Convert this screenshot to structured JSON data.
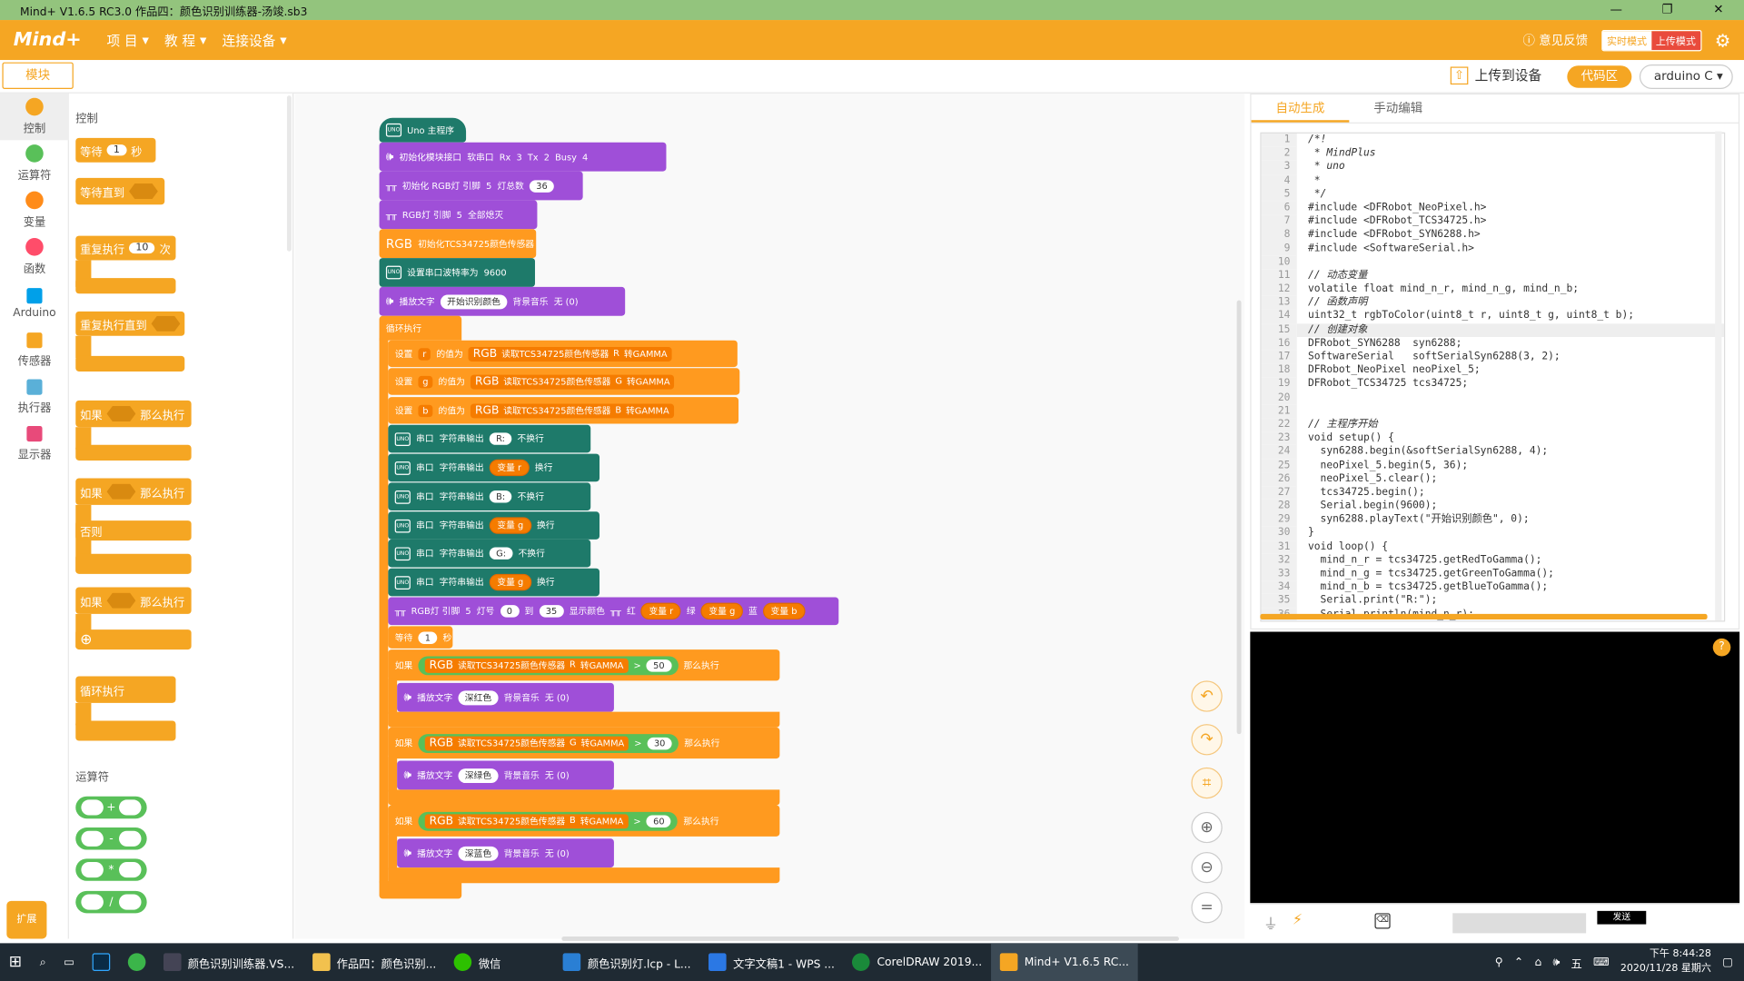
{
  "window": {
    "title": "Mind+ V1.6.5 RC3.0    作品四：颜色识别训练器-汤竣.sb3",
    "min": "—",
    "max": "❐",
    "close": "✕"
  },
  "menubar": {
    "logo": "Mind+",
    "items": [
      "项 目",
      "教 程",
      "连接设备"
    ],
    "feedback": "意见反馈",
    "mode_realtime": "实时模式",
    "mode_upload": "上传模式"
  },
  "toolbar": {
    "blocks_tab": "模块",
    "upload": "上传到设备",
    "code_btn": "代码区",
    "language": "arduino C"
  },
  "categories": [
    {
      "label": "控制",
      "color": "#f5a623"
    },
    {
      "label": "运算符",
      "color": "#59c059"
    },
    {
      "label": "变量",
      "color": "#ff8c1a"
    },
    {
      "label": "函数",
      "color": "#ff4d6a"
    },
    {
      "label": "Arduino",
      "color": "#00a0e9"
    },
    {
      "label": "传感器",
      "color": "#f5a623"
    },
    {
      "label": "执行器",
      "color": "#5ab0d8"
    },
    {
      "label": "显示器",
      "color": "#e84a7a"
    }
  ],
  "ext_button": "扩展",
  "flyout": {
    "control_title": "控制",
    "wait": "等待",
    "wait_val": "1",
    "wait_unit": "秒",
    "wait_until": "等待直到",
    "repeat": "重复执行",
    "repeat_val": "10",
    "repeat_unit": "次",
    "repeat_until": "重复执行直到",
    "if1": "如果",
    "then1": "那么执行",
    "if2": "如果",
    "then2": "那么执行",
    "else2": "否则",
    "if3": "如果",
    "then3": "那么执行",
    "forever": "循环执行",
    "operators_title": "运算符",
    "ops": [
      "+",
      "-",
      "*",
      "/"
    ]
  },
  "script": {
    "main": "Uno 主程序",
    "b1": {
      "label": "初始化模块接口",
      "mode": "软串口",
      "rx": "Rx",
      "rxv": "3",
      "tx": "Tx",
      "txv": "2",
      "busy": "Busy",
      "busyv": "4"
    },
    "b2": {
      "label": "初始化 RGB灯 引脚",
      "pin": "5",
      "cnt_label": "灯总数",
      "cnt": "36"
    },
    "b3": {
      "label": "RGB灯 引脚",
      "pin": "5",
      "action": "全部熄灭"
    },
    "b4": {
      "rgb": "RGB",
      "label": "初始化TCS34725颜色传感器"
    },
    "b5": {
      "label": "设置串口波特率为",
      "val": "9600"
    },
    "b6": {
      "label": "播放文字",
      "text": "开始识别颜色",
      "bg": "背景音乐",
      "bgv": "无 (0)"
    },
    "forever": "循环执行",
    "set": [
      {
        "label": "设置",
        "var": "r",
        "to": "的值为",
        "rgb": "RGB",
        "sensor": "读取TCS34725颜色传感器",
        "ch": "R",
        "gamma": "转GAMMA"
      },
      {
        "label": "设置",
        "var": "g",
        "to": "的值为",
        "rgb": "RGB",
        "sensor": "读取TCS34725颜色传感器",
        "ch": "G",
        "gamma": "转GAMMA"
      },
      {
        "label": "设置",
        "var": "b",
        "to": "的值为",
        "rgb": "RGB",
        "sensor": "读取TCS34725颜色传感器",
        "ch": "B",
        "gamma": "转GAMMA"
      }
    ],
    "serial": [
      {
        "port": "串口",
        "out": "字符串输出",
        "val": "R:",
        "nl": "不换行",
        "var": false
      },
      {
        "port": "串口",
        "out": "字符串输出",
        "val": "变量 r",
        "nl": "换行",
        "var": true
      },
      {
        "port": "串口",
        "out": "字符串输出",
        "val": "B:",
        "nl": "不换行",
        "var": false
      },
      {
        "port": "串口",
        "out": "字符串输出",
        "val": "变量 g",
        "nl": "换行",
        "var": true
      },
      {
        "port": "串口",
        "out": "字符串输出",
        "val": "G:",
        "nl": "不换行",
        "var": false
      },
      {
        "port": "串口",
        "out": "字符串输出",
        "val": "变量 g",
        "nl": "换行",
        "var": true
      }
    ],
    "rgbshow": {
      "label": "RGB灯 引脚",
      "pin": "5",
      "lamp": "灯号",
      "from": "0",
      "to": "到",
      "end": "35",
      "show": "显示颜色",
      "r": "红",
      "rv": "变量 r",
      "g": "绿",
      "gv": "变量 g",
      "b": "蓝",
      "bv": "变量 b"
    },
    "wait": {
      "label": "等待",
      "val": "1",
      "unit": "秒"
    },
    "ifs": [
      {
        "if": "如果",
        "rgb": "RGB",
        "sensor": "读取TCS34725颜色传感器",
        "ch": "R",
        "gamma": "转GAMMA",
        "op": ">",
        "val": "50",
        "then": "那么执行",
        "play": "播放文字",
        "text": "深红色",
        "bg": "背景音乐",
        "bgv": "无 (0)"
      },
      {
        "if": "如果",
        "rgb": "RGB",
        "sensor": "读取TCS34725颜色传感器",
        "ch": "G",
        "gamma": "转GAMMA",
        "op": ">",
        "val": "30",
        "then": "那么执行",
        "play": "播放文字",
        "text": "深绿色",
        "bg": "背景音乐",
        "bgv": "无 (0)"
      },
      {
        "if": "如果",
        "rgb": "RGB",
        "sensor": "读取TCS34725颜色传感器",
        "ch": "B",
        "gamma": "转GAMMA",
        "op": ">",
        "val": "60",
        "then": "那么执行",
        "play": "播放文字",
        "text": "深蓝色",
        "bg": "背景音乐",
        "bgv": "无 (0)"
      }
    ]
  },
  "codepanel": {
    "tab_auto": "自动生成",
    "tab_manual": "手动编辑",
    "lines": [
      "/*!",
      " * MindPlus",
      " * uno",
      " *",
      " */",
      "#include <DFRobot_NeoPixel.h>",
      "#include <DFRobot_TCS34725.h>",
      "#include <DFRobot_SYN6288.h>",
      "#include <SoftwareSerial.h>",
      "",
      "// 动态变量",
      "volatile float mind_n_r, mind_n_g, mind_n_b;",
      "// 函数声明",
      "uint32_t rgbToColor(uint8_t r, uint8_t g, uint8_t b);",
      "// 创建对象",
      "DFRobot_SYN6288  syn6288;",
      "SoftwareSerial   softSerialSyn6288(3, 2);",
      "DFRobot_NeoPixel neoPixel_5;",
      "DFRobot_TCS34725 tcs34725;",
      "",
      "",
      "// 主程序开始",
      "void setup() {",
      "  syn6288.begin(&softSerialSyn6288, 4);",
      "  neoPixel_5.begin(5, 36);",
      "  neoPixel_5.clear();",
      "  tcs34725.begin();",
      "  Serial.begin(9600);",
      "  syn6288.playText(\"开始识别颜色\", 0);",
      "}",
      "void loop() {",
      "  mind_n_r = tcs34725.getRedToGamma();",
      "  mind_n_g = tcs34725.getGreenToGamma();",
      "  mind_n_b = tcs34725.getBlueToGamma();",
      "  Serial.print(\"R:\");",
      "  Serial.println(mind_n_r);"
    ]
  },
  "serialpanel": {
    "send": "发送"
  },
  "taskbar": {
    "apps": [
      "颜色识别训练器.VS...",
      "作品四：颜色识别...",
      "微信",
      "颜色识别灯.lcp - L...",
      "文字文稿1 - WPS ...",
      "CorelDRAW 2019...",
      "Mind+ V1.6.5 RC..."
    ],
    "ime": "五",
    "time": "下午 8:44:28",
    "date": "2020/11/28 星期六"
  }
}
